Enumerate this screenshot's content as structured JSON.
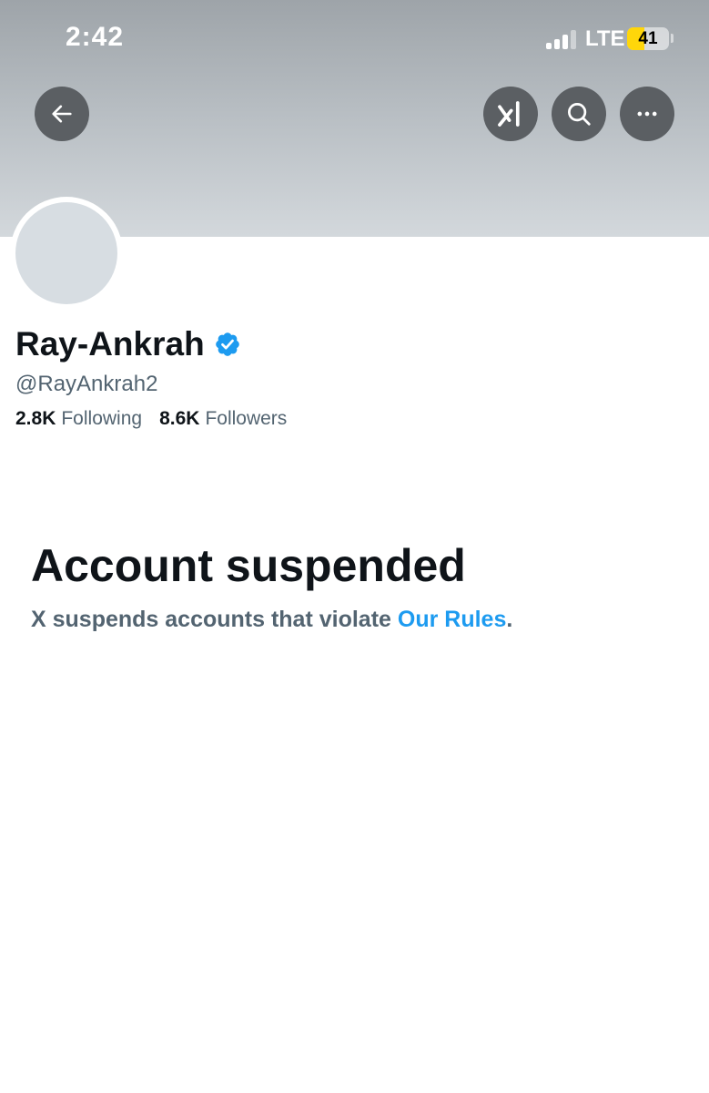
{
  "status_bar": {
    "time": "2:42",
    "network": "LTE",
    "battery_level": "41",
    "battery_fraction": 0.41,
    "signal_icon": "cellular-signal-icon"
  },
  "header_buttons": {
    "back_icon": "arrow-left-icon",
    "grok_icon": "grok-icon",
    "search_icon": "search-icon",
    "more_icon": "more-horizontal-icon"
  },
  "profile": {
    "display_name": "Ray-Ankrah",
    "verified_icon": "verified-badge-icon",
    "handle": "@RayAnkrah2",
    "following_count": "2.8K",
    "following_label": "Following",
    "followers_count": "8.6K",
    "followers_label": "Followers"
  },
  "notice": {
    "title": "Account suspended",
    "text": "X suspends accounts that violate ",
    "link": "Our Rules",
    "suffix": "."
  },
  "colors": {
    "accent": "#1d9bf0",
    "text_primary": "#0f1419",
    "text_secondary": "#536471",
    "battery": "#ffd60a"
  }
}
